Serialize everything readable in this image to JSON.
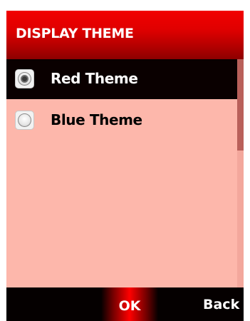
{
  "header": {
    "title": "DISPLAY THEME"
  },
  "theme_options": [
    {
      "label": "Red Theme",
      "selected": true
    },
    {
      "label": "Blue Theme",
      "selected": false
    }
  ],
  "softkeys": {
    "ok_label": "OK",
    "back_label": "Back"
  },
  "colors": {
    "header_red": "#df0000",
    "list_background": "#fdb7ab",
    "selection_highlight": "#0a0000",
    "softkey_bar": "#050000",
    "scroll_thumb": "#b9605a"
  },
  "icons": {
    "selected_radio": "radio-selected-icon",
    "unselected_radio": "radio-unselected-icon"
  }
}
